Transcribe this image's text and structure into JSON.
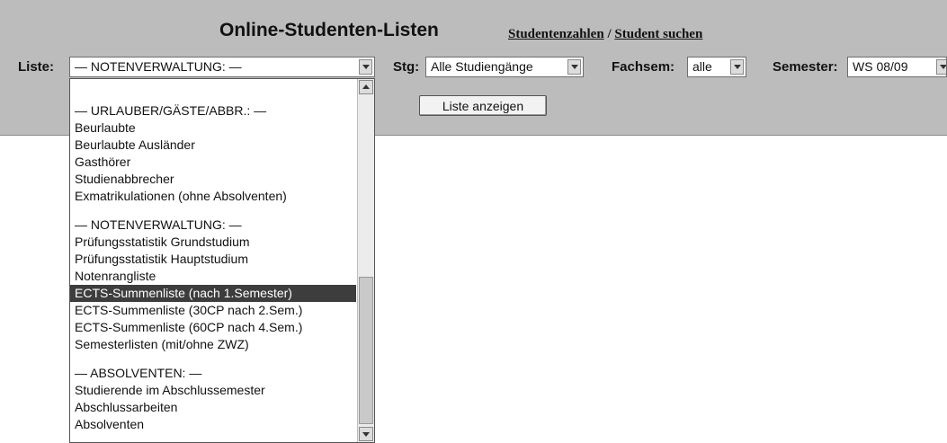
{
  "header": {
    "title": "Online-Studenten-Listen",
    "link_student_numbers": "Studentenzahlen",
    "link_separator": " / ",
    "link_student_search": "Student suchen"
  },
  "filters": {
    "list_label": "Liste:",
    "list_value": "— NOTENVERWALTUNG: —",
    "stg_label": "Stg:",
    "stg_value": "Alle Studiengänge",
    "fachsem_label": "Fachsem:",
    "fachsem_value": "alle",
    "semester_label": "Semester:",
    "semester_value": "WS 08/09"
  },
  "show_list_button": "Liste anzeigen",
  "dropdown": {
    "selected_option": "ECTS-Summenliste (nach 1.Semester)",
    "groups": [
      {
        "header": "— URLAUBER/GÄSTE/ABBR.: —",
        "items": [
          "Beurlaubte",
          "Beurlaubte Ausländer",
          "Gasthörer",
          "Studienabbrecher",
          "Exmatrikulationen (ohne Absolventen)"
        ]
      },
      {
        "header": "— NOTENVERWALTUNG: —",
        "items": [
          "Prüfungsstatistik Grundstudium",
          "Prüfungsstatistik Hauptstudium",
          "Notenrangliste",
          "ECTS-Summenliste (nach 1.Semester)",
          "ECTS-Summenliste (30CP nach 2.Sem.)",
          "ECTS-Summenliste (60CP nach 4.Sem.)",
          "Semesterlisten (mit/ohne ZWZ)"
        ]
      },
      {
        "header": "— ABSOLVENTEN: —",
        "items": [
          "Studierende im Abschlussemester",
          "Abschlussarbeiten",
          "Absolventen"
        ]
      }
    ],
    "scroll_position": 0.62
  }
}
